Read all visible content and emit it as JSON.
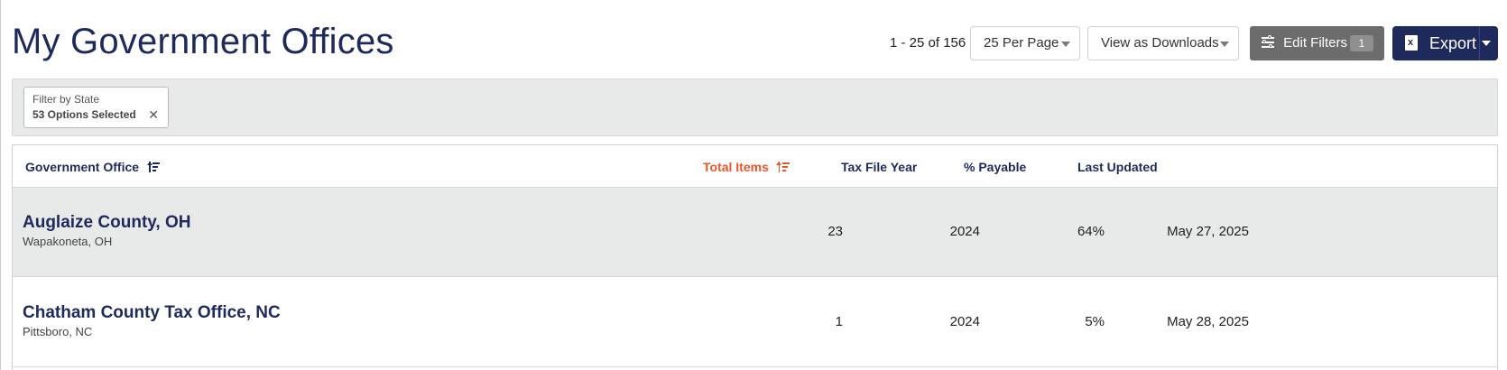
{
  "page": {
    "title": "My Government Offices"
  },
  "toolbar": {
    "pagination_text": "1 - 25 of 156",
    "per_page": "25 Per Page",
    "view_as": "View as Downloads",
    "edit_filters_label": "Edit Filters",
    "edit_filters_count": "1",
    "export_label": "Export"
  },
  "filters": [
    {
      "label": "Filter by State",
      "value": "53 Options Selected"
    }
  ],
  "table": {
    "columns": [
      {
        "label": "Government Office",
        "sortable": true,
        "active": false
      },
      {
        "label": "Total Items",
        "sortable": true,
        "active": true
      },
      {
        "label": "Tax File Year",
        "sortable": false,
        "active": false
      },
      {
        "label": "% Payable",
        "sortable": false,
        "active": false
      },
      {
        "label": "Last Updated",
        "sortable": false,
        "active": false
      }
    ],
    "rows": [
      {
        "name": "Auglaize County, OH",
        "location": "Wapakoneta, OH",
        "total_items": "23",
        "tax_file_year": "2024",
        "payable": "64%",
        "last_updated": "May 27, 2025"
      },
      {
        "name": "Chatham County Tax Office, NC",
        "location": "Pittsboro, NC",
        "total_items": "1",
        "tax_file_year": "2024",
        "payable": "5%",
        "last_updated": "May 28, 2025"
      }
    ]
  },
  "colors": {
    "brand_navy": "#1f2a5c",
    "active_sort": "#e8562a",
    "filter_button": "#6c6c6c",
    "row_shade": "#e8e9e9"
  },
  "icons": {
    "sort": "sort-ascending-icon",
    "filters": "sliders-icon",
    "export": "excel-file-icon",
    "remove": "close-icon",
    "dropdown": "chevron-down-icon"
  }
}
